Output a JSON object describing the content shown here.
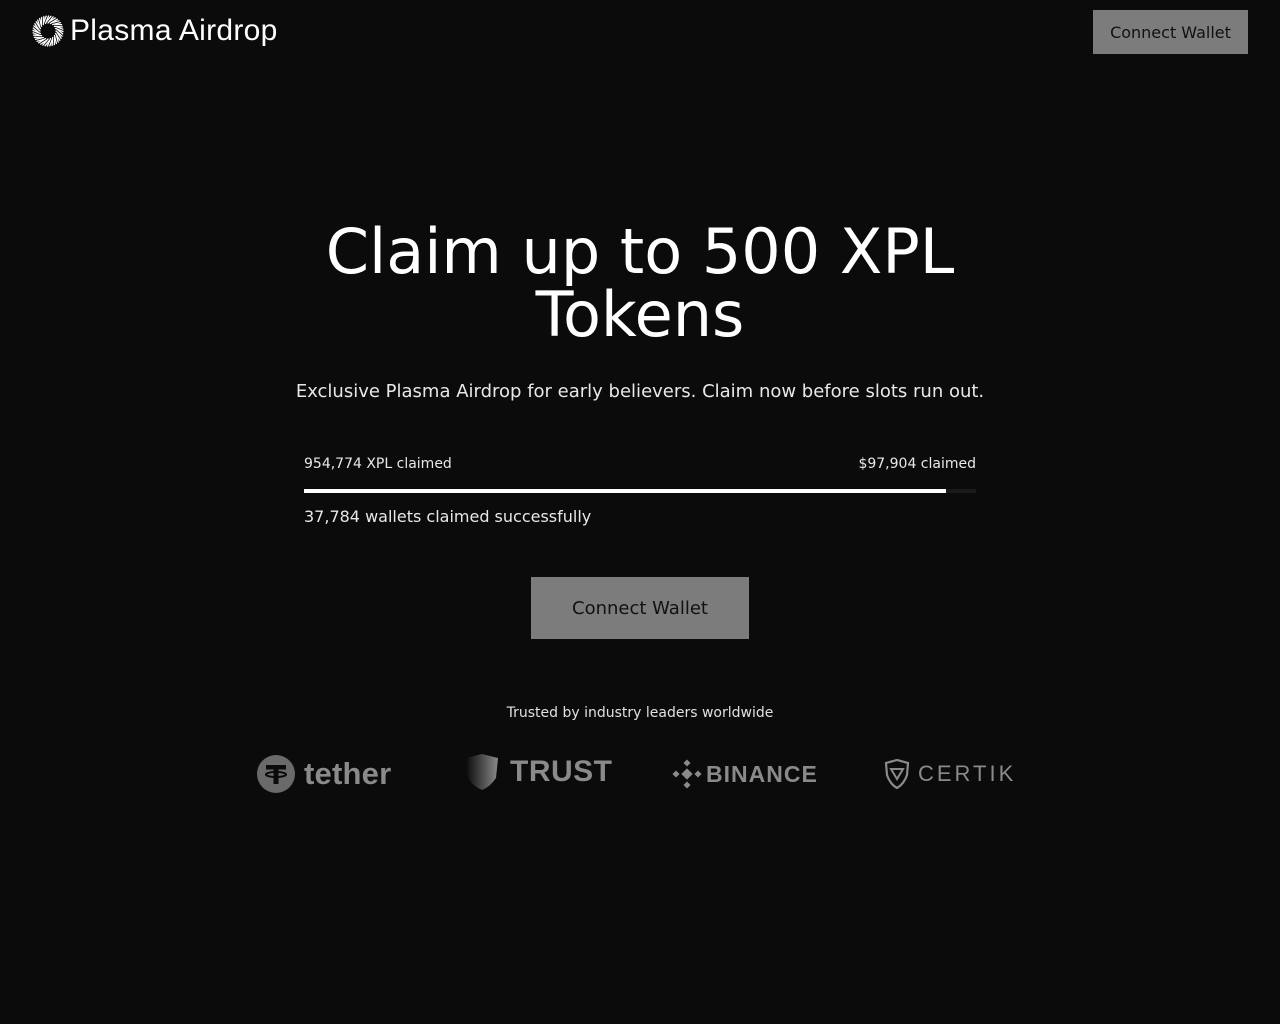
{
  "header": {
    "brand_name": "Plasma Airdrop",
    "connect_label": "Connect Wallet"
  },
  "hero": {
    "title": "Claim up to 500 XPL Tokens",
    "subtitle": "Exclusive Plasma Airdrop for early believers. Claim now before slots run out."
  },
  "stats": {
    "xpl_claimed": "954,774 XPL claimed",
    "usd_claimed": "$97,904 claimed",
    "progress_fraction": 0.955,
    "wallets_claimed": "37,784 wallets claimed successfully"
  },
  "cta": {
    "connect_label": "Connect Wallet"
  },
  "partners": {
    "heading": "Trusted by industry leaders worldwide",
    "items": [
      {
        "name": "tether",
        "icon": "tether-icon"
      },
      {
        "name": "TRUST",
        "icon": "trust-shield-icon"
      },
      {
        "name": "BINANCE",
        "icon": "binance-icon"
      },
      {
        "name": "CERTIK",
        "icon": "certik-icon"
      }
    ]
  },
  "colors": {
    "background": "#0b0b0b",
    "button": "#7c7c7c",
    "progress": "#ffffff",
    "partner_logo": "#8a8a8a"
  }
}
